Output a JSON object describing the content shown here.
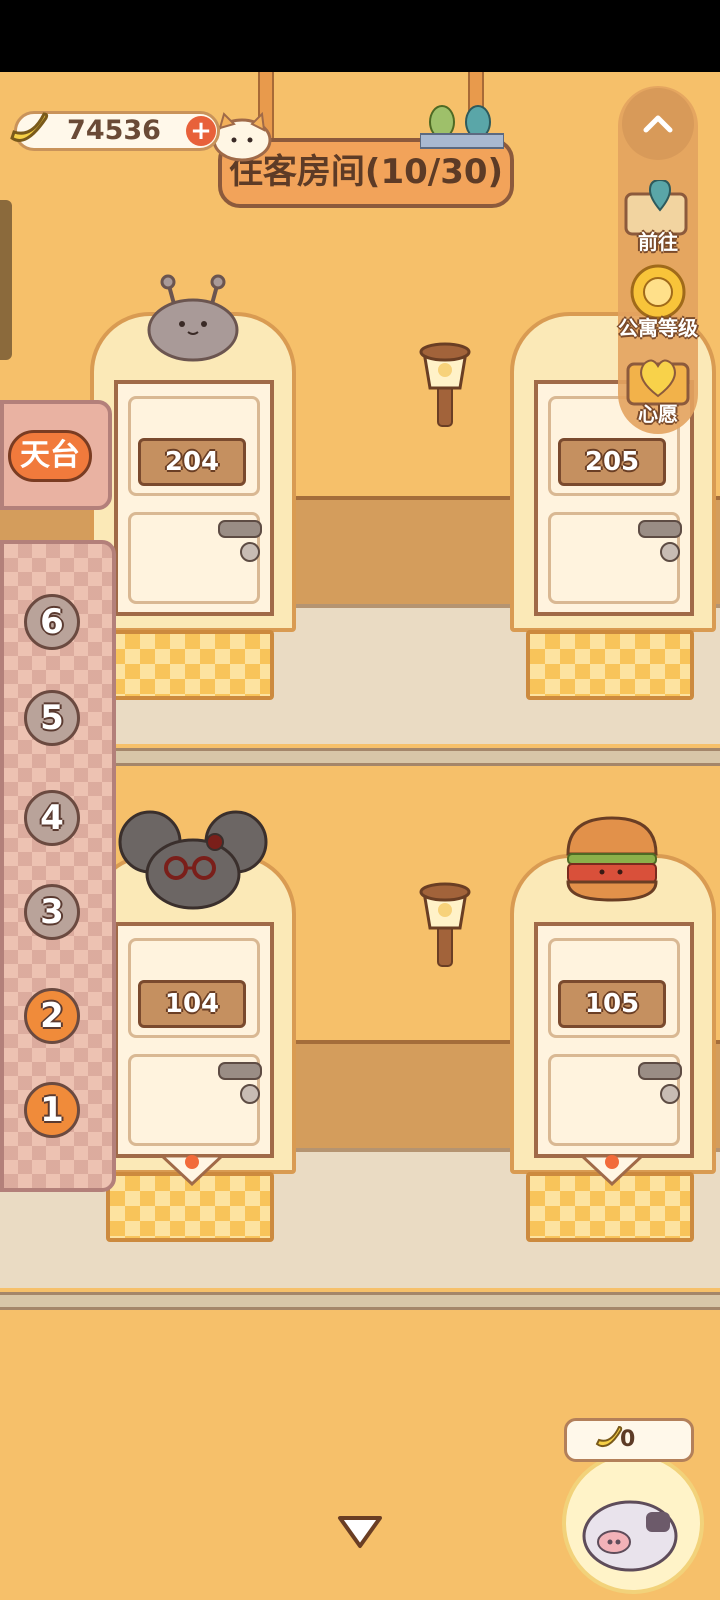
{
  "currency": {
    "amount": "74536",
    "add_icon": "plus",
    "icon": "banana-icon"
  },
  "title": {
    "text": "住客房间(10/30)"
  },
  "right_menu": {
    "collapse_icon": "chevron-up",
    "items": [
      {
        "label": "前往",
        "icon": "map-pin-icon"
      },
      {
        "label": "公寓等级",
        "icon": "sun-badge-icon"
      },
      {
        "label": "心愿",
        "icon": "heart-book-icon"
      }
    ]
  },
  "rooftop": {
    "label": "天台"
  },
  "floors": {
    "buttons": [
      "6",
      "5",
      "4",
      "3",
      "2",
      "1"
    ],
    "active": [
      "2",
      "1"
    ]
  },
  "rooms": {
    "upper": [
      {
        "number": "204",
        "occupant": "gray-slug"
      },
      {
        "number": "205",
        "occupant": "none"
      }
    ],
    "lower": [
      {
        "number": "104",
        "occupant": "gray-mouse"
      },
      {
        "number": "105",
        "occupant": "burger"
      }
    ]
  },
  "collector": {
    "count": "0"
  },
  "colors": {
    "wall": "#f6c06a",
    "accent": "#f08b3a",
    "wood": "#c59060"
  }
}
